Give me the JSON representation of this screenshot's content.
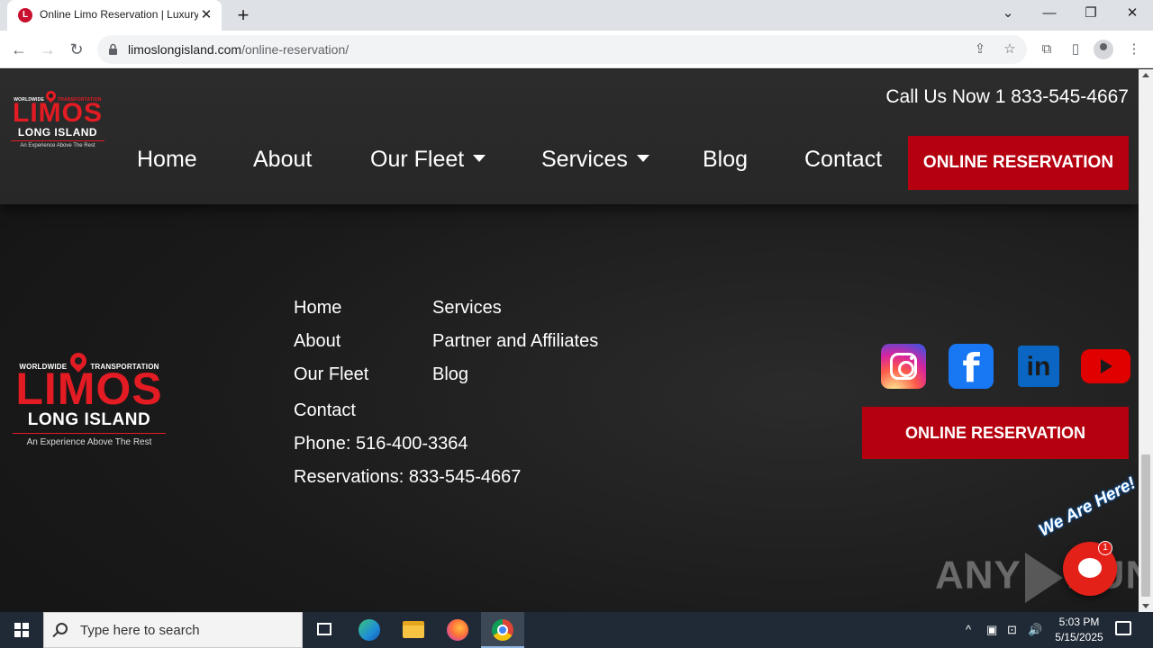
{
  "browser": {
    "tab_title": "Online Limo Reservation | Luxury",
    "favicon_letter": "L",
    "tab_close": "✕",
    "new_tab": "+",
    "url_domain": "limoslongisland.com",
    "url_path": "/online-reservation/",
    "window_controls": {
      "tab_search": "⌄",
      "minimize": "—",
      "restore": "❐",
      "close": "✕"
    },
    "nav": {
      "back": "←",
      "forward": "→",
      "reload": "↻"
    },
    "icons": {
      "share": "⇪",
      "bookmark": "☆",
      "extensions": "⧉",
      "sidepanel": "▯",
      "menu": "⋮"
    }
  },
  "header": {
    "call_us": "Call Us Now 1 833-545-4667",
    "nav_items": [
      "Home",
      "About",
      "Our Fleet",
      "Services",
      "Blog",
      "Contact"
    ],
    "reserve_button": "ONLINE RESERVATION"
  },
  "logo": {
    "top_left": "WORLDWIDE",
    "top_right": "TRANSPORTATION",
    "name": "LIMOS",
    "subname": "LONG ISLAND",
    "tagline": "An Experience Above The Rest"
  },
  "footer": {
    "col1": [
      "Home",
      "About",
      "Our Fleet",
      "Contact"
    ],
    "col2": [
      "Services",
      "Partner and Affiliates",
      "Blog"
    ],
    "phone": "Phone: 516-400-3364",
    "reservations": "Reservations: 833-545-4667",
    "social": [
      "instagram-icon",
      "facebook-icon",
      "linkedin-icon",
      "youtube-icon"
    ],
    "facebook_glyph": "f",
    "linkedin_glyph": "in",
    "reserve_button": "ONLINE RESERVATION"
  },
  "overlay": {
    "watermark": "ANY RUN",
    "chat_tag": "We Are Here!",
    "chat_badge": "1",
    "chat_close": "✕"
  },
  "taskbar": {
    "search_placeholder": "Type here to search",
    "time": "5:03 PM",
    "date": "5/15/2025",
    "tray": {
      "chevron": "^",
      "network": "⊡",
      "volume": "🔊"
    }
  },
  "colors": {
    "brand_red": "#b5000f",
    "logo_red": "#e31b23",
    "page_bg": "#1b1b1b"
  }
}
